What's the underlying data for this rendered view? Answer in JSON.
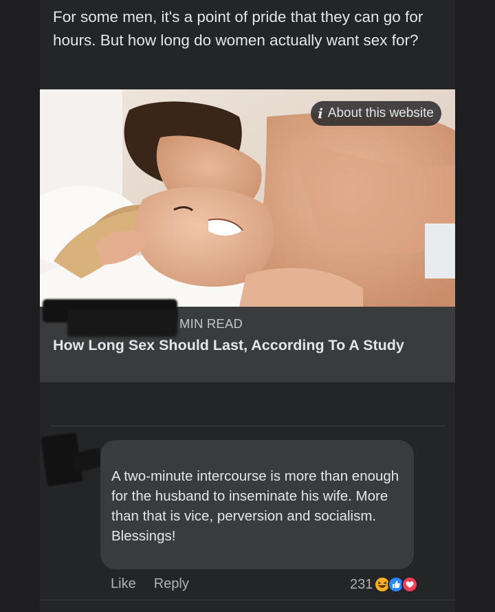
{
  "post": {
    "text": "For some men, it's a point of pride that they can go for hours. But how long do women actually want sex for?"
  },
  "link_card": {
    "about_label": "About this website",
    "about_icon": "info-icon",
    "read_time": "MIN READ",
    "title": "How Long Sex Should Last, According To A Study"
  },
  "comment": {
    "text": "A two-minute intercourse is more than enough for the husband to inseminate his wife. More than that is vice, perversion and socialism. Blessings!",
    "like_label": "Like",
    "reply_label": "Reply",
    "reaction_count": "231",
    "reactions": [
      "haha-icon",
      "like-icon",
      "love-icon"
    ]
  },
  "colors": {
    "background": "#1e1e21",
    "card": "#3a3b3c",
    "text": "#e4e6eb",
    "muted": "#b0b3b8",
    "like_blue": "#2d88ff",
    "love_red": "#f33e58",
    "haha_yellow": "#f7b125"
  }
}
